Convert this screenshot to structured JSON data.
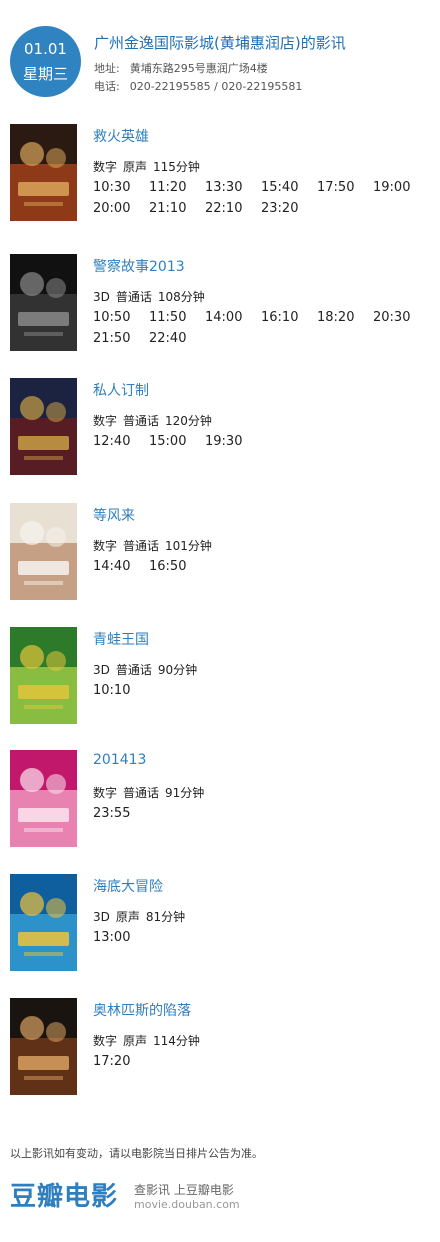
{
  "header": {
    "date": "01.01",
    "weekday": "星期三",
    "cinema_title": "广州金逸国际影城(黄埔惠润店)的影讯",
    "address_label": "地址:",
    "address": "黄埔东路295号惠润广场4楼",
    "phone_label": "电话:",
    "phone": "020-22195585 / 020-22195581"
  },
  "movies": [
    {
      "title": "救火英雄",
      "format": "数字",
      "language": "原声",
      "duration": "115分钟",
      "times": [
        "10:30",
        "11:20",
        "13:30",
        "15:40",
        "17:50",
        "19:00",
        "20:00",
        "21:10",
        "22:10",
        "23:20"
      ],
      "poster_colors": [
        "#2a1a12",
        "#b0461c",
        "#d9a55a"
      ]
    },
    {
      "title": "警察故事2013",
      "format": "3D",
      "language": "普通话",
      "duration": "108分钟",
      "times": [
        "10:50",
        "11:50",
        "14:00",
        "16:10",
        "18:20",
        "20:30",
        "21:50",
        "22:40"
      ],
      "poster_colors": [
        "#111111",
        "#3d3d3d",
        "#8a8a8a"
      ]
    },
    {
      "title": "私人订制",
      "format": "数字",
      "language": "普通话",
      "duration": "120分钟",
      "times": [
        "12:40",
        "15:00",
        "19:30"
      ],
      "poster_colors": [
        "#1c2340",
        "#6b1b1b",
        "#c9a045"
      ]
    },
    {
      "title": "等风来",
      "format": "数字",
      "language": "普通话",
      "duration": "101分钟",
      "times": [
        "14:40",
        "16:50"
      ],
      "poster_colors": [
        "#e8e0d2",
        "#b98b6a",
        "#f6f3ee"
      ]
    },
    {
      "title": "青蛙王国",
      "format": "3D",
      "language": "普通话",
      "duration": "90分钟",
      "times": [
        "10:10"
      ],
      "poster_colors": [
        "#2c7a2a",
        "#a8d44a",
        "#e3c53b"
      ]
    },
    {
      "title": "201413",
      "format": "数字",
      "language": "普通话",
      "duration": "91分钟",
      "times": [
        "23:55"
      ],
      "poster_colors": [
        "#c2186b",
        "#f3a6c8",
        "#fbe4ee"
      ]
    },
    {
      "title": "海底大冒险",
      "format": "3D",
      "language": "原声",
      "duration": "81分钟",
      "times": [
        "13:00"
      ],
      "poster_colors": [
        "#0f5f9e",
        "#38a3d8",
        "#f0c23a"
      ]
    },
    {
      "title": "奥林匹斯的陷落",
      "format": "数字",
      "language": "原声",
      "duration": "114分钟",
      "times": [
        "17:20"
      ],
      "poster_colors": [
        "#1a1410",
        "#7a3b1a",
        "#d8a062"
      ]
    }
  ],
  "footer": {
    "note": "以上影讯如有变动，请以电影院当日排片公告为准。",
    "brand": "豆瓣电影",
    "slogan": "查影讯  上豆瓣电影",
    "url": "movie.douban.com"
  }
}
